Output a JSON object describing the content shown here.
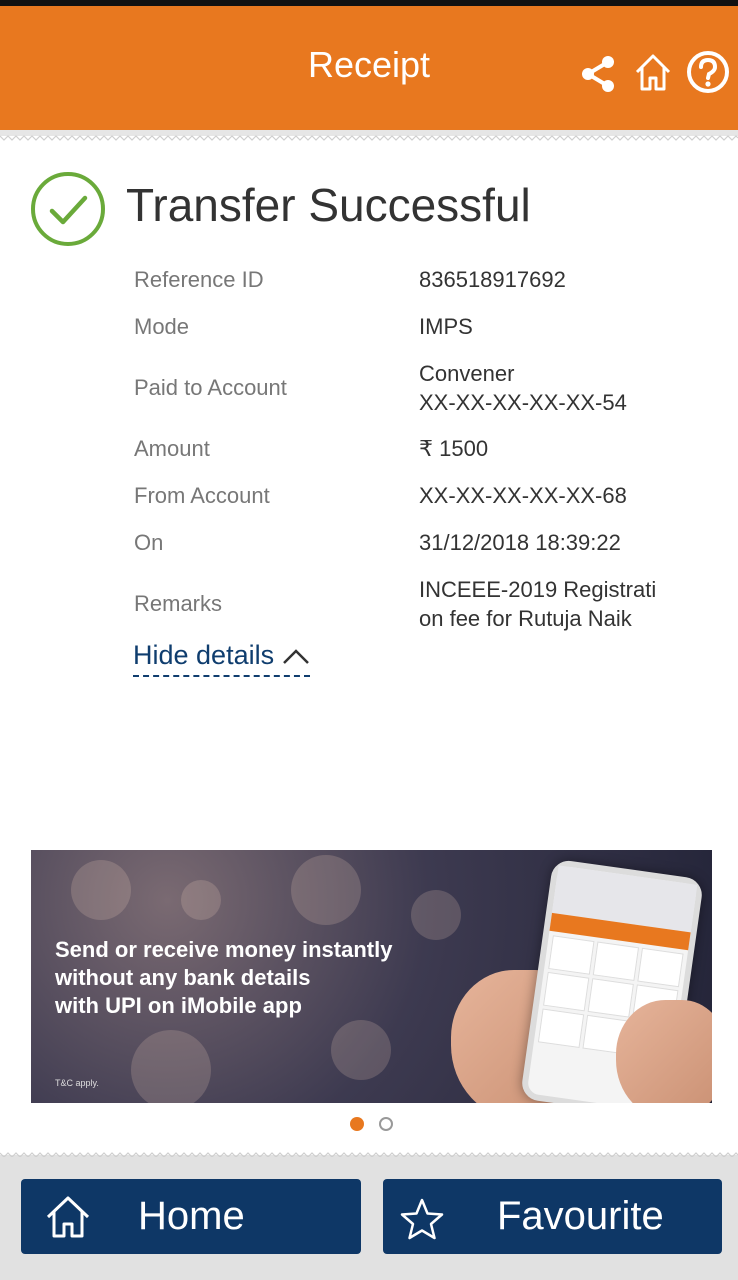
{
  "header": {
    "title": "Receipt",
    "icons": [
      "share-icon",
      "home-icon",
      "help-icon"
    ],
    "bg_color": "#e8781f"
  },
  "status": {
    "icon": "check-circle-icon",
    "title": "Transfer Successful",
    "color": "#6aaa3a"
  },
  "details": [
    {
      "label": "Reference ID",
      "value": "836518917692"
    },
    {
      "label": "Mode",
      "value": "IMPS"
    },
    {
      "label": "Paid to Account",
      "value": "Convener\nXX-XX-XX-XX-XX-54"
    },
    {
      "label": "Amount",
      "value": "₹ 1500"
    },
    {
      "label": "From Account",
      "value": "XX-XX-XX-XX-XX-68"
    },
    {
      "label": "On",
      "value": "31/12/2018 18:39:22"
    },
    {
      "label": "Remarks",
      "value": "INCEEE-2019 Registrati\non fee for Rutuja Naik"
    }
  ],
  "hide_details": {
    "label": "Hide details",
    "icon": "chevron-up-icon"
  },
  "banner": {
    "text": "Send or receive money instantly\nwithout any bank details\nwith UPI on iMobile app",
    "tc": "T&C apply.",
    "pagination": {
      "count": 2,
      "active": 1
    }
  },
  "footer": {
    "home_label": "Home",
    "favourite_label": "Favourite",
    "button_color": "#0e3766"
  }
}
